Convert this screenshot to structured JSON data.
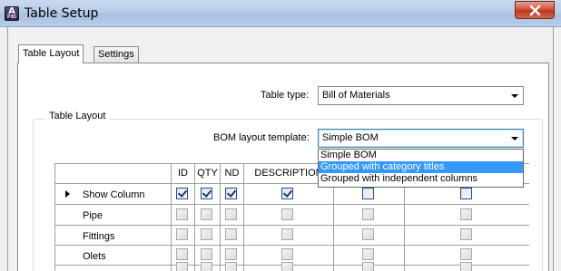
{
  "window": {
    "title": "Table Setup",
    "icon_letter": "A",
    "icon_sub": "P3D",
    "close_icon": "close-icon"
  },
  "tabs": [
    {
      "label": "Table Layout",
      "active": true
    },
    {
      "label": "Settings",
      "active": false
    }
  ],
  "table_type": {
    "label": "Table type:",
    "value": "Bill of Materials"
  },
  "group": {
    "title": "Table Layout"
  },
  "bom_template": {
    "label": "BOM layout template:",
    "value": "Simple BOM",
    "options": [
      {
        "label": "Simple BOM",
        "selected": false
      },
      {
        "label": "Grouped with category titles",
        "selected": true
      },
      {
        "label": "Grouped with independent columns",
        "selected": false
      }
    ]
  },
  "grid": {
    "columns": [
      "ID",
      "QTY",
      "ND",
      "DESCRIPTION",
      "",
      ""
    ],
    "rows": [
      {
        "label": "Show Column",
        "current": true,
        "enabled": true,
        "checks": [
          true,
          true,
          true,
          true,
          false,
          false
        ]
      },
      {
        "label": "Pipe",
        "current": false,
        "enabled": false,
        "checks": [
          false,
          false,
          false,
          false,
          false,
          false
        ]
      },
      {
        "label": "Fittings",
        "current": false,
        "enabled": false,
        "checks": [
          false,
          false,
          false,
          false,
          false,
          false
        ]
      },
      {
        "label": "Olets",
        "current": false,
        "enabled": false,
        "checks": [
          false,
          false,
          false,
          false,
          false,
          false
        ]
      },
      {
        "label": "",
        "current": false,
        "enabled": false,
        "checks": [
          false,
          false,
          false,
          false,
          false,
          false
        ]
      }
    ]
  },
  "colors": {
    "selection": "#3399ff",
    "titlebar": "#b9cde8",
    "close_button": "#c7432a"
  }
}
